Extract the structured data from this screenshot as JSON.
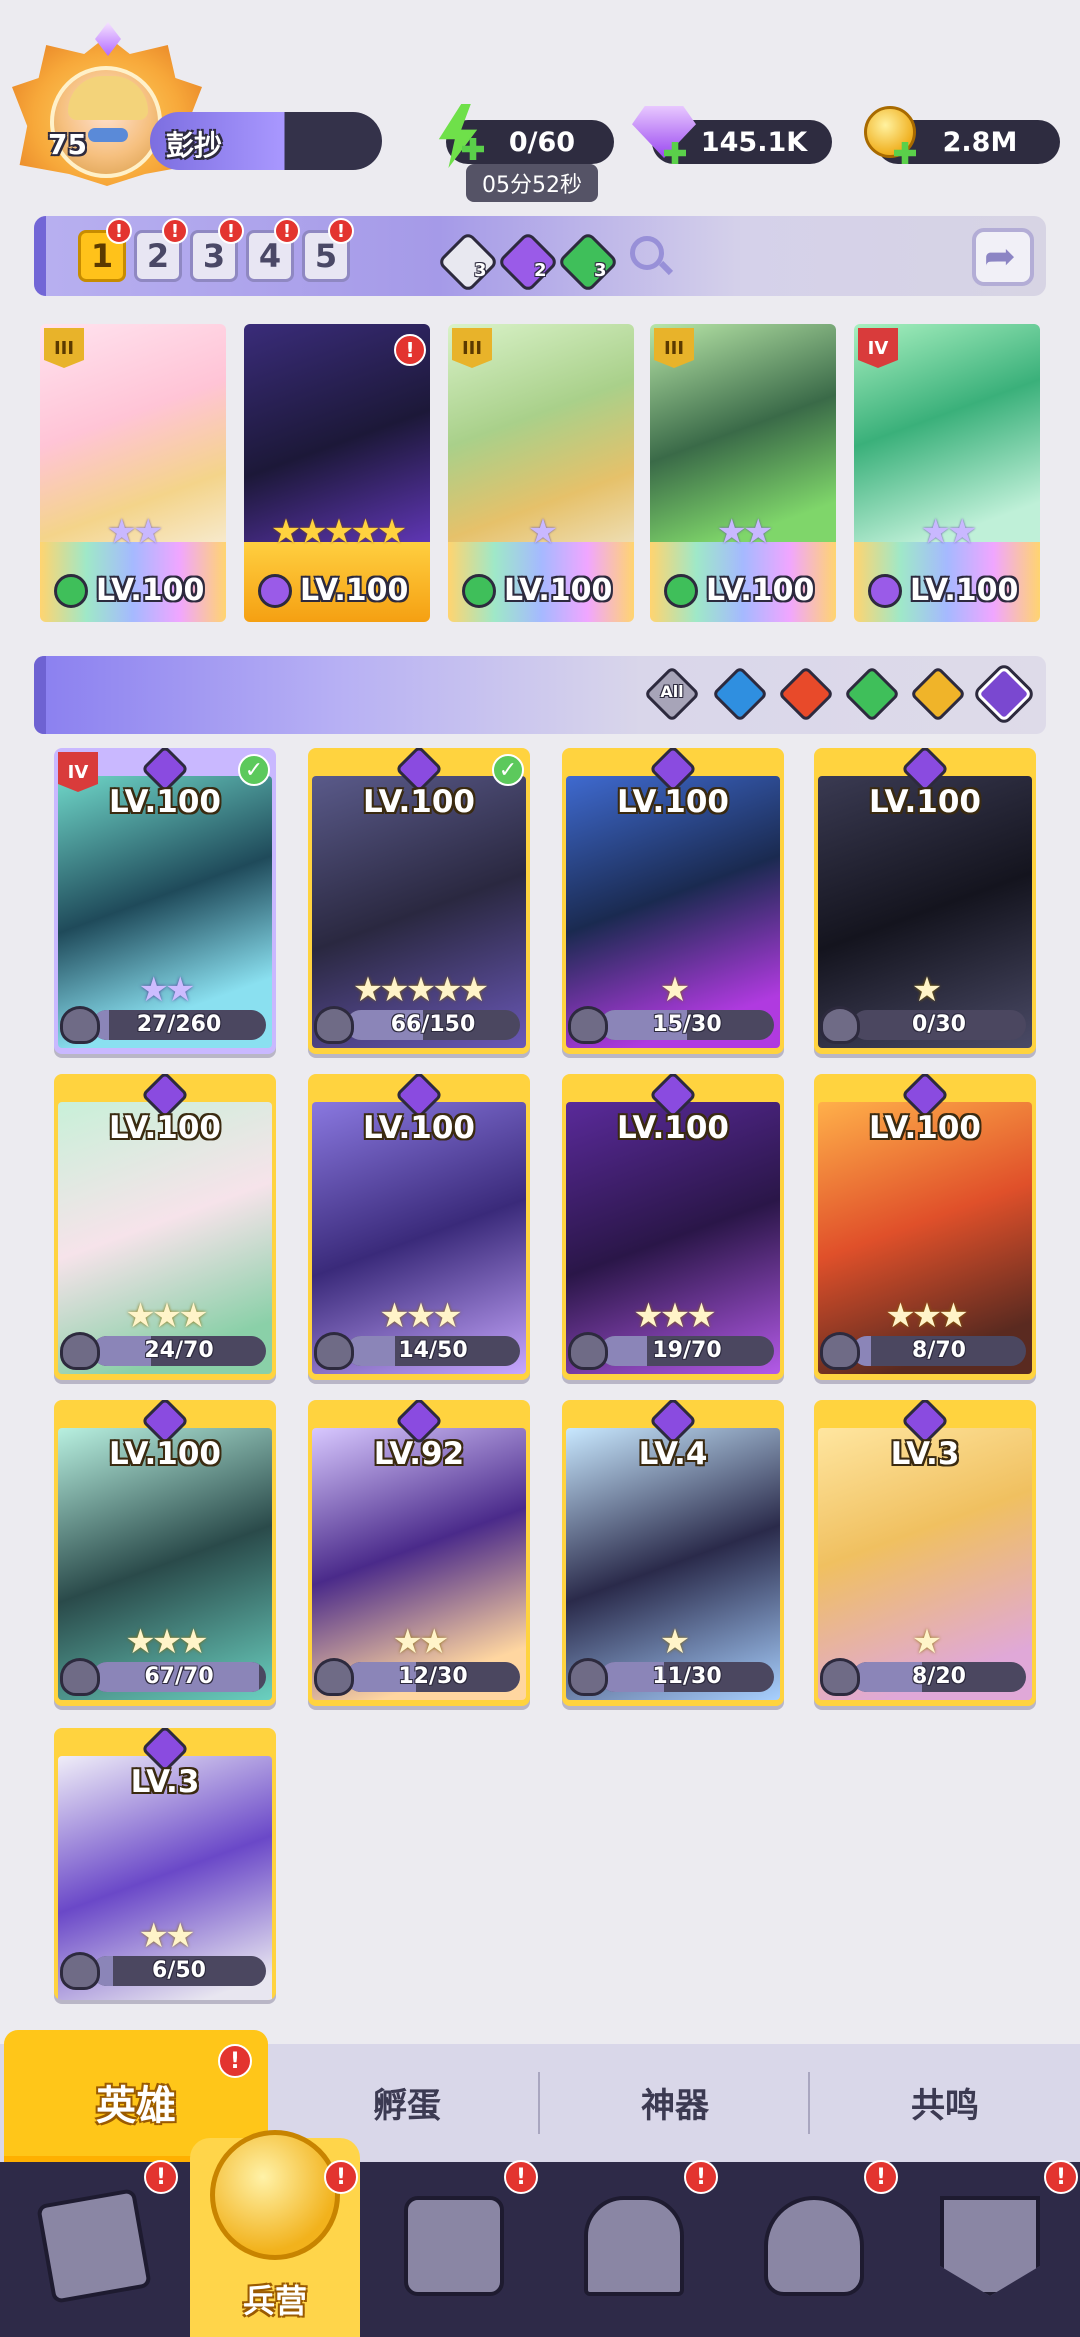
{
  "player": {
    "level": "75",
    "name": "彭抄"
  },
  "resources": {
    "energy": "0/60",
    "energy_timer": "05分52秒",
    "gems": "145.1K",
    "gold": "2.8M"
  },
  "team_slots": [
    "1",
    "2",
    "3",
    "4",
    "5"
  ],
  "element_tokens": [
    {
      "icon": "question-element-icon",
      "count": "3",
      "color": "#e8e8f0"
    },
    {
      "icon": "dark-element-icon",
      "count": "2",
      "color": "#9a5be8"
    },
    {
      "icon": "nature-element-icon",
      "count": "3",
      "color": "#3fbf5a"
    }
  ],
  "team": [
    {
      "tier": "III",
      "tier_color": "gold",
      "stars": "★★",
      "star_style": "purple",
      "level": "LV.100",
      "element": "nature-element-icon",
      "element_color": "#3fbf5a",
      "art": "linear-gradient(160deg,#ffe3ef,#ffc4d6 40%,#f4d48a 70%,#f8f0e0)"
    },
    {
      "tier": "",
      "tier_color": "",
      "stars": "★★★★★",
      "star_style": "gold",
      "level": "LV.100",
      "element": "dark-element-icon",
      "element_color": "#9a5be8",
      "art": "linear-gradient(160deg,#3a2c7a,#1c1838 50%,#6a3bc8)"
    },
    {
      "tier": "III",
      "tier_color": "gold",
      "stars": "★",
      "star_style": "purple",
      "level": "LV.100",
      "element": "nature-element-icon",
      "element_color": "#3fbf5a",
      "art": "linear-gradient(160deg,#d9f2c8,#a9d08a 40%,#e6c16a 70%,#f0e6c8)"
    },
    {
      "tier": "III",
      "tier_color": "gold",
      "stars": "★★",
      "star_style": "purple",
      "level": "LV.100",
      "element": "nature-element-icon",
      "element_color": "#3fbf5a",
      "art": "linear-gradient(160deg,#b8e6a8,#3a6a48 45%,#7fd66a 80%)"
    },
    {
      "tier": "IV",
      "tier_color": "red",
      "stars": "★★",
      "star_style": "purple",
      "level": "LV.100",
      "element": "dark-element-icon",
      "element_color": "#9a5be8",
      "art": "linear-gradient(160deg,#a8f0c0,#3ab07a 40%,#bff0d8 80%)"
    }
  ],
  "filters": [
    {
      "label": "All",
      "icon": "all-filter-icon",
      "color": "#a7a4b8"
    },
    {
      "label": "",
      "icon": "water-element-icon",
      "color": "#2f8fe0"
    },
    {
      "label": "",
      "icon": "fire-element-icon",
      "color": "#e84a2a"
    },
    {
      "label": "",
      "icon": "nature-element-icon",
      "color": "#3fbf5a"
    },
    {
      "label": "",
      "icon": "light-element-icon",
      "color": "#f0b429"
    },
    {
      "label": "",
      "icon": "dark-element-icon",
      "color": "#7a48d0"
    }
  ],
  "roster": [
    {
      "level": "LV.100",
      "stars": "★★",
      "star_style": "purple",
      "progress": "27/260",
      "fill": 0.1,
      "tier": "IV",
      "check": true,
      "art": "linear-gradient(160deg,#6fd6c8,#1f4a5a 45%,#8ae0f0 80%)",
      "frame": "#c9b8ff"
    },
    {
      "level": "LV.100",
      "stars": "★★★★★",
      "star_style": "gold",
      "progress": "66/150",
      "fill": 0.44,
      "tier": "",
      "check": true,
      "art": "linear-gradient(160deg,#5a5a8a,#2a2840 50%,#6a58b8)",
      "frame": "#ffd33f"
    },
    {
      "level": "LV.100",
      "stars": "★",
      "star_style": "gold",
      "progress": "15/30",
      "fill": 0.5,
      "tier": "",
      "check": false,
      "art": "linear-gradient(160deg,#3f6ad0,#1a2a50 45%,#b03ae0 85%)",
      "frame": "#ffd33f"
    },
    {
      "level": "LV.100",
      "stars": "★",
      "star_style": "gold",
      "progress": "0/30",
      "fill": 0.0,
      "tier": "",
      "check": false,
      "art": "linear-gradient(160deg,#3a3a52,#14141e 50%,#4a4a66)",
      "frame": "#ffd33f"
    },
    {
      "level": "LV.100",
      "stars": "★★★",
      "star_style": "gold",
      "progress": "24/70",
      "fill": 0.34,
      "tier": "",
      "check": false,
      "art": "linear-gradient(160deg,#c8f0d8,#f6e3ea 45%,#8ad0a8 85%)",
      "frame": "#ffd33f"
    },
    {
      "level": "LV.100",
      "stars": "★★★",
      "star_style": "gold",
      "progress": "14/50",
      "fill": 0.28,
      "tier": "",
      "check": false,
      "art": "linear-gradient(160deg,#8a78e0,#3a2a7a 50%,#c8a8ff)",
      "frame": "#ffd33f"
    },
    {
      "level": "LV.100",
      "stars": "★★★",
      "star_style": "gold",
      "progress": "19/70",
      "fill": 0.27,
      "tier": "",
      "check": false,
      "art": "linear-gradient(160deg,#5a2a9a,#2a1648 50%,#b45ae8)",
      "frame": "#ffd33f"
    },
    {
      "level": "LV.100",
      "stars": "★★★",
      "star_style": "gold",
      "progress": "8/70",
      "fill": 0.11,
      "tier": "",
      "check": false,
      "art": "linear-gradient(160deg,#ffb04a,#e0502a 45%,#5a2a20 85%)",
      "frame": "#ffd33f"
    },
    {
      "level": "LV.100",
      "stars": "★★★",
      "star_style": "gold",
      "progress": "67/70",
      "fill": 0.96,
      "tier": "",
      "check": false,
      "art": "linear-gradient(160deg,#b8f0e0,#2a4a4a 50%,#6ad0c0)",
      "frame": "#ffd33f"
    },
    {
      "level": "LV.92",
      "stars": "★★",
      "star_style": "gold",
      "progress": "12/30",
      "fill": 0.4,
      "tier": "",
      "check": false,
      "art": "linear-gradient(160deg,#d8c8ff,#4a2a8a 45%,#ffd6a0 85%)",
      "frame": "#ffd33f"
    },
    {
      "level": "LV.4",
      "stars": "★",
      "star_style": "gold",
      "progress": "11/30",
      "fill": 0.37,
      "tier": "",
      "check": false,
      "art": "linear-gradient(160deg,#c8e8ff,#2a2a4a 50%,#a8d0ff)",
      "frame": "#ffd33f"
    },
    {
      "level": "LV.3",
      "stars": "★",
      "star_style": "gold",
      "progress": "8/20",
      "fill": 0.4,
      "tier": "",
      "check": false,
      "art": "linear-gradient(160deg,#ffe6a0,#f0c060 40%,#e0a8d8 85%)",
      "frame": "#ffd33f"
    },
    {
      "level": "LV.3",
      "stars": "★★",
      "star_style": "gold",
      "progress": "6/50",
      "fill": 0.12,
      "tier": "",
      "check": false,
      "art": "linear-gradient(160deg,#f0eef8,#6a48c8 45%,#e8e6f0 85%)",
      "frame": "#ffd33f"
    }
  ],
  "subtabs": {
    "active": "英雄",
    "t2": "孵蛋",
    "t3": "神器",
    "t4": "共鸣"
  },
  "nav": {
    "active_label": "兵营"
  },
  "colors": {
    "accent_yellow": "#ffc619",
    "nav_bg": "#2e2a48",
    "notify_red": "#e3342f"
  }
}
